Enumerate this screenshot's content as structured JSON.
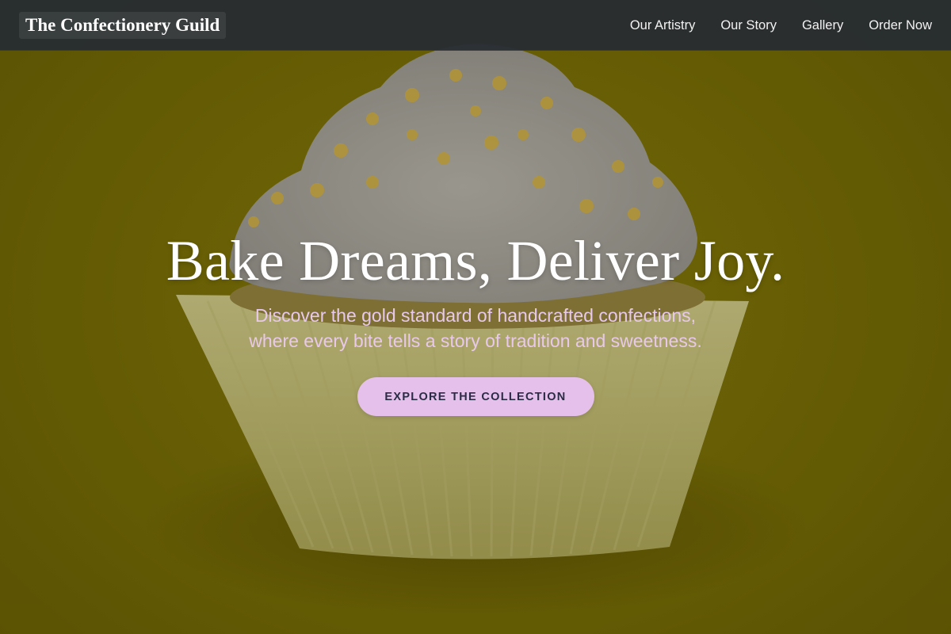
{
  "nav": {
    "brand": "The Confectionery Guild",
    "links": [
      {
        "label": "Our Artistry"
      },
      {
        "label": "Our Story"
      },
      {
        "label": "Gallery"
      },
      {
        "label": "Order Now"
      }
    ]
  },
  "hero": {
    "title": "Bake Dreams, Deliver Joy.",
    "subtitle_line1": "Discover the gold standard of handcrafted confections,",
    "subtitle_line2": "where every bite tells a story of tradition and sweetness.",
    "cta_label": "EXPLORE THE COLLECTION",
    "background_image": "cupcake-photo"
  },
  "colors": {
    "nav_background": "#262c32",
    "hero_background": "#6b6204",
    "accent": "#e4c0ea",
    "subtitle_text": "#e8c9ea",
    "cta_text": "#2a2b44"
  }
}
